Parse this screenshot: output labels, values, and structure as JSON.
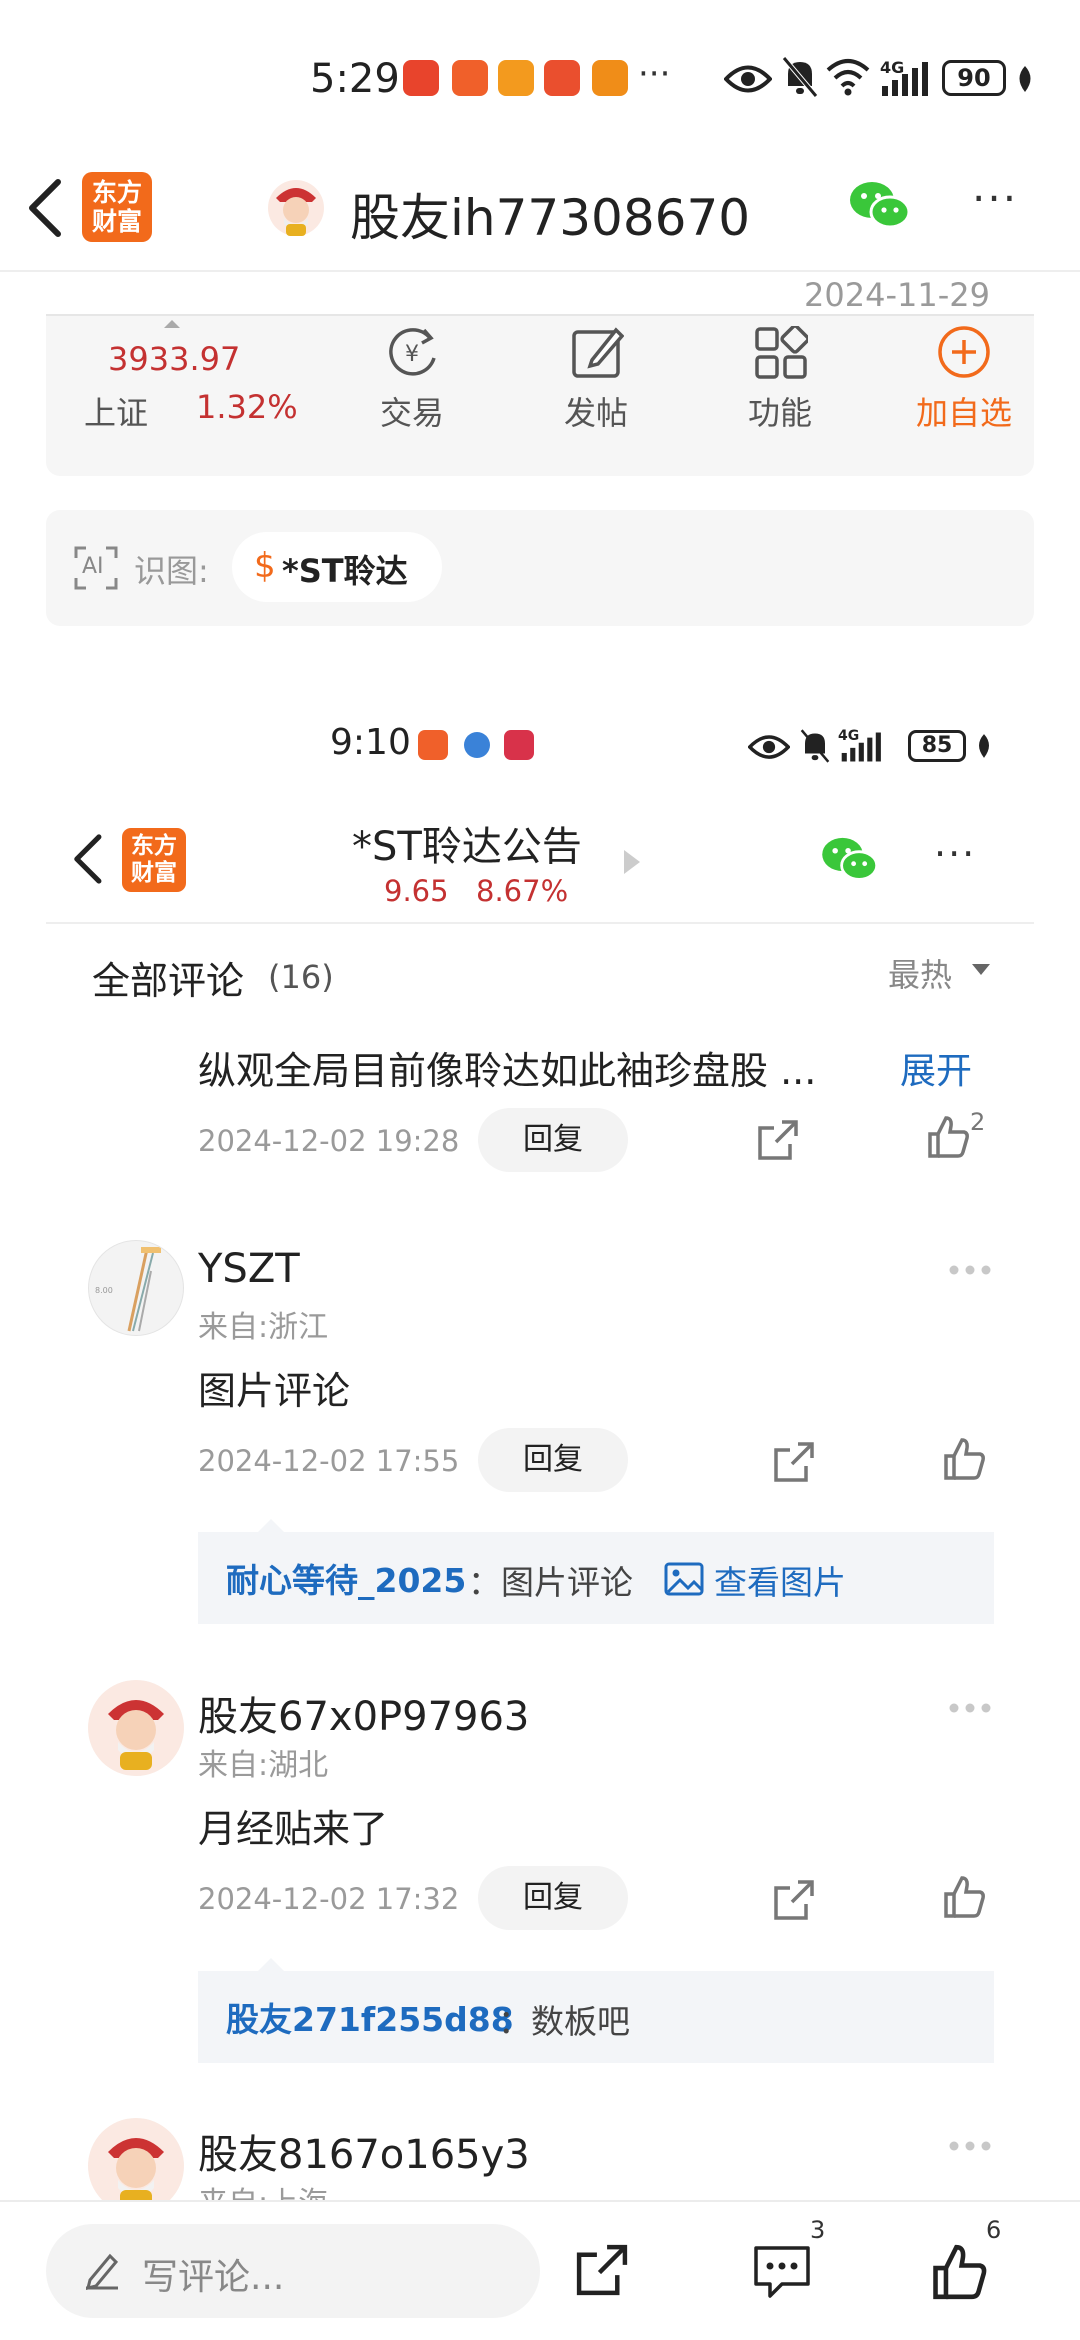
{
  "status_bar_top": {
    "time": "5:29",
    "more": "···",
    "network": "4G",
    "battery": "90"
  },
  "header": {
    "logo_text_line1": "东方",
    "logo_text_line2": "财富",
    "title": "股友ih77308670",
    "more": "···"
  },
  "top_card": {
    "date": "2024-11-29",
    "index_value": "3933.97",
    "index_name": "上证",
    "index_change": "1.32%",
    "actions": [
      {
        "label": "交易",
        "icon": "yen-refresh-icon"
      },
      {
        "label": "发帖",
        "icon": "edit-icon"
      },
      {
        "label": "功能",
        "icon": "grid-icon"
      },
      {
        "label": "加自选",
        "icon": "add-circle-icon"
      }
    ]
  },
  "recognize": {
    "ai_label": "AI",
    "label": "识图:",
    "symbol": "$",
    "stock": "*ST聆达"
  },
  "status_bar_inner": {
    "time": "9:10",
    "network": "4G",
    "battery": "85"
  },
  "inner_header": {
    "logo_text_line1": "东方",
    "logo_text_line2": "财富",
    "title": "*ST聆达公告",
    "price": "9.65",
    "change": "8.67%",
    "more": "···"
  },
  "comments_header": {
    "title": "全部评论",
    "count": "(16)",
    "sort": "最热"
  },
  "comments": [
    {
      "text": "纵观全局目前像聆达如此袖珍盘股 ...",
      "expand": "展开",
      "date": "2024-12-02 19:28",
      "reply": "回复",
      "likes": "2"
    },
    {
      "user": "YSZT",
      "from": "来自:浙江",
      "text": "图片评论",
      "date": "2024-12-02 17:55",
      "reply": "回复",
      "quote_user": "耐心等待_2025",
      "quote_text": "：图片评论",
      "quote_link": "查看图片"
    },
    {
      "user": "股友67x0P97963",
      "from": "来自:湖北",
      "text": "月经贴来了",
      "date": "2024-12-02 17:32",
      "reply": "回复",
      "quote_user": "股友271f255d88",
      "quote_text": "：数板吧"
    },
    {
      "user": "股友8167o165y3",
      "from": "来自:上海"
    }
  ],
  "bottom_bar": {
    "placeholder": "写评论...",
    "comment_count": "3",
    "like_count": "6"
  },
  "colors": {
    "brand_orange": "#f26a1b",
    "wechat_green": "#3ac73a",
    "price_red": "#c43131",
    "link_blue": "#1e6bbf"
  }
}
